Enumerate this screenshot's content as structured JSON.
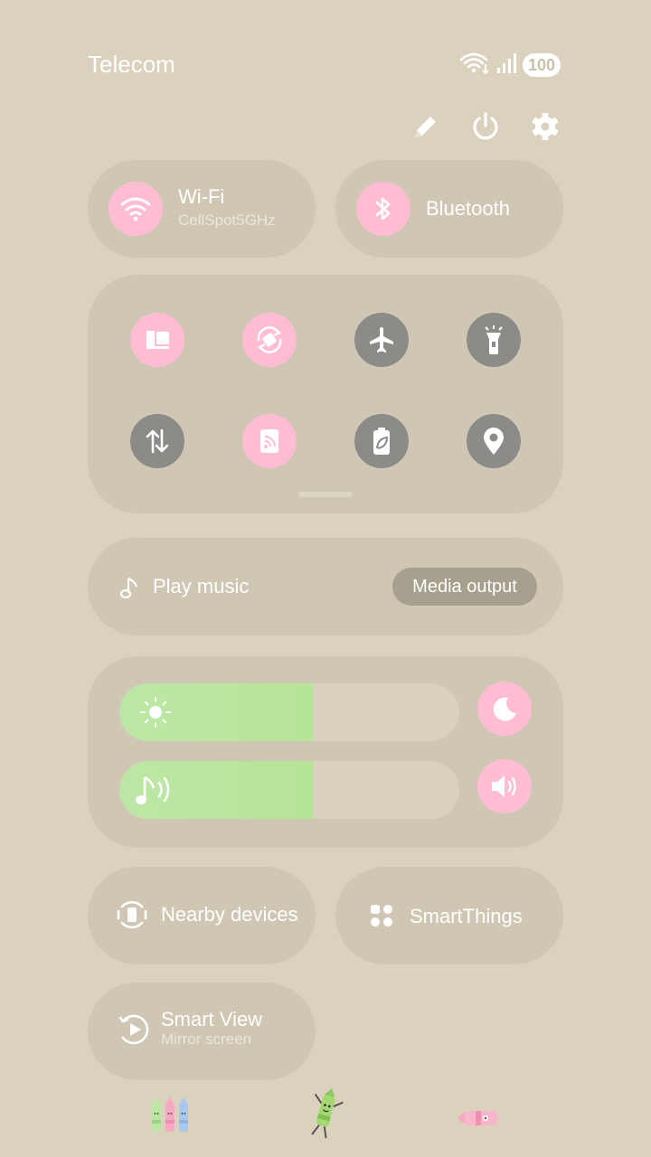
{
  "status_bar": {
    "carrier": "Telecom",
    "battery": "100",
    "icons": [
      "wifi-icon",
      "signal-icon"
    ]
  },
  "header_actions": [
    "edit-icon",
    "power-icon",
    "settings-icon"
  ],
  "connectivity": {
    "wifi": {
      "title": "Wi-Fi",
      "subtitle": "CellSpot5GHz",
      "icon": "wifi-icon",
      "active": true
    },
    "bluetooth": {
      "title": "Bluetooth",
      "icon": "bluetooth-icon",
      "active": true
    }
  },
  "quick_toggles": [
    {
      "name": "device-control",
      "icon": "device-control-icon",
      "active": true
    },
    {
      "name": "auto-rotate",
      "icon": "rotate-icon",
      "active": true
    },
    {
      "name": "airplane-mode",
      "icon": "airplane-icon",
      "active": false
    },
    {
      "name": "flashlight",
      "icon": "flashlight-icon",
      "active": false
    },
    {
      "name": "mobile-data",
      "icon": "data-arrows-icon",
      "active": false
    },
    {
      "name": "mobile-hotspot",
      "icon": "hotspot-icon",
      "active": true
    },
    {
      "name": "power-saving",
      "icon": "battery-leaf-icon",
      "active": false
    },
    {
      "name": "location",
      "icon": "location-pin-icon",
      "active": false
    }
  ],
  "media": {
    "label": "Play music",
    "output_button": "Media output",
    "icon": "music-note-icon"
  },
  "sliders": {
    "brightness": {
      "level": 0.57,
      "icon": "sun-icon",
      "side_icon": "moon-icon"
    },
    "volume": {
      "level": 0.57,
      "icon": "music-sound-icon",
      "side_icon": "speaker-icon"
    }
  },
  "bottom_tiles": {
    "nearby": {
      "title": "Nearby devices",
      "icon": "nearby-devices-icon"
    },
    "smartthings": {
      "title": "SmartThings",
      "icon": "smartthings-icon"
    },
    "smartview": {
      "title": "Smart View",
      "subtitle": "Mirror screen",
      "icon": "smart-view-icon"
    }
  },
  "colors": {
    "background": "#dad2bd",
    "tile": "#cfc7b3",
    "accent_pink": "#ffbdd3",
    "inactive_gray": "#8c8b88",
    "slider_fill": "#b6e496"
  }
}
